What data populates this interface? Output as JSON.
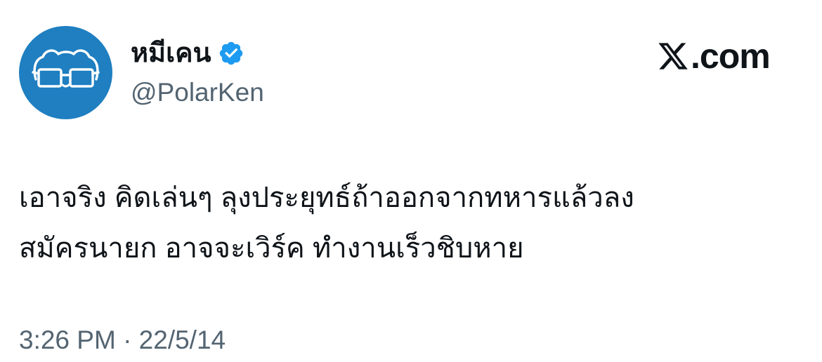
{
  "author": {
    "display_name": "หมีเคน",
    "handle": "@PolarKen",
    "verified": true,
    "avatar_icon": "polar-bear-glasses-icon",
    "avatar_color": "#1f7fc1"
  },
  "watermark": {
    "logo_icon": "x-logo-icon",
    "text": ".com"
  },
  "tweet": {
    "text": "เอาจริง คิดเล่นๆ ลุงประยุทธ์ถ้าออกจากทหารแล้วลง\nสมัครนายก อาจจะเวิร์ค ทำงานเร็วชิบหาย",
    "timestamp": "3:26 PM · 22/5/14"
  },
  "colors": {
    "text_primary": "#0f1419",
    "text_secondary": "#536471",
    "verified_badge": "#1d9bf0"
  }
}
